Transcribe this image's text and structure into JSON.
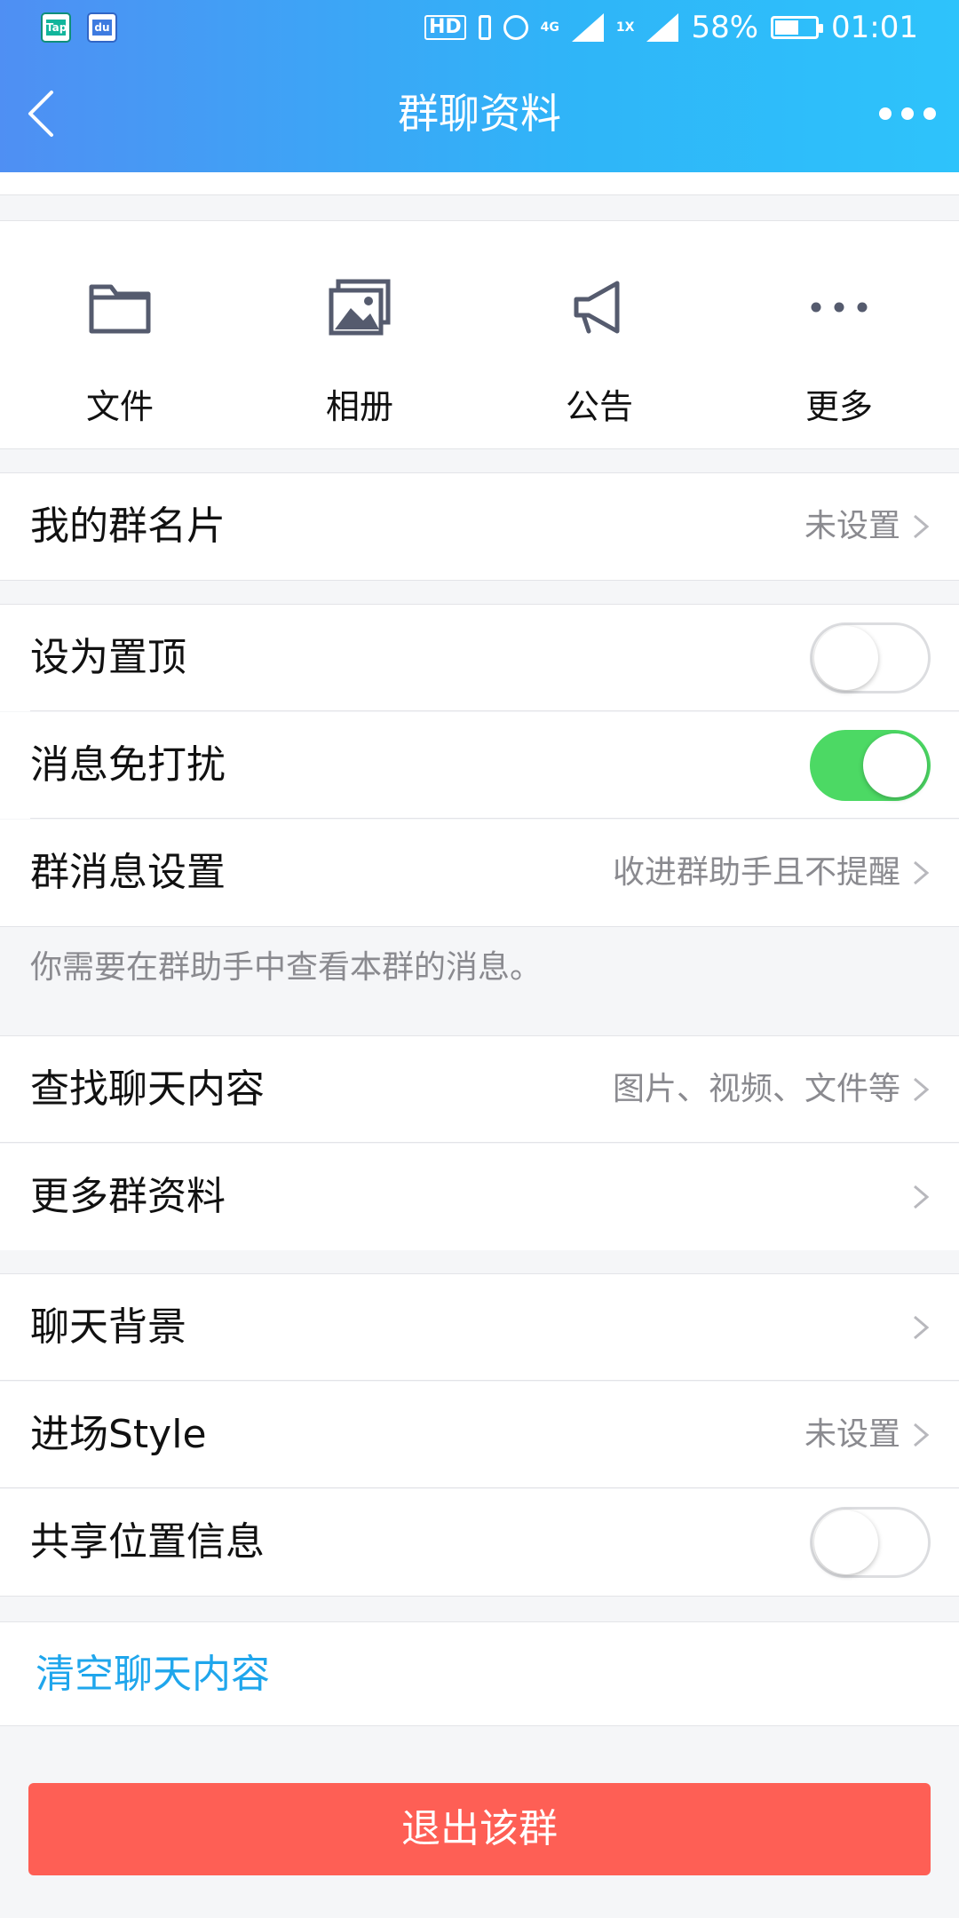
{
  "status_bar": {
    "app_icons": [
      "Tap",
      "du"
    ],
    "hd": "HD",
    "network_4g": "4G",
    "network_1x": "1X",
    "battery_percent": "58%",
    "battery_level": 0.58,
    "time": "01:01"
  },
  "nav": {
    "title": "群聊资料"
  },
  "quick_actions": [
    {
      "label": "文件",
      "icon": "folder-icon"
    },
    {
      "label": "相册",
      "icon": "photo-album-icon"
    },
    {
      "label": "公告",
      "icon": "megaphone-icon"
    },
    {
      "label": "更多",
      "icon": "more-dots-icon"
    }
  ],
  "rows": {
    "group_card": {
      "label": "我的群名片",
      "value": "未设置"
    },
    "pin_top": {
      "label": "设为置顶",
      "toggle": false
    },
    "do_not_disturb": {
      "label": "消息免打扰",
      "toggle": true
    },
    "group_msg_settings": {
      "label": "群消息设置",
      "value": "收进群助手且不提醒"
    },
    "hint": "你需要在群助手中查看本群的消息。",
    "search_chat": {
      "label": "查找聊天内容",
      "value": "图片、视频、文件等"
    },
    "more_group_info": {
      "label": "更多群资料"
    },
    "chat_background": {
      "label": "聊天背景"
    },
    "entry_style": {
      "label": "进场Style",
      "value": "未设置"
    },
    "share_location": {
      "label": "共享位置信息",
      "toggle": false
    }
  },
  "clear_chat": "清空聊天内容",
  "exit_group": "退出该群",
  "colors": {
    "header_gradient_start": "#4f8ff3",
    "header_gradient_end": "#2ec3fb",
    "toggle_on": "#4cd964",
    "link_blue": "#1fa6ec",
    "danger_red": "#fe5f55"
  }
}
